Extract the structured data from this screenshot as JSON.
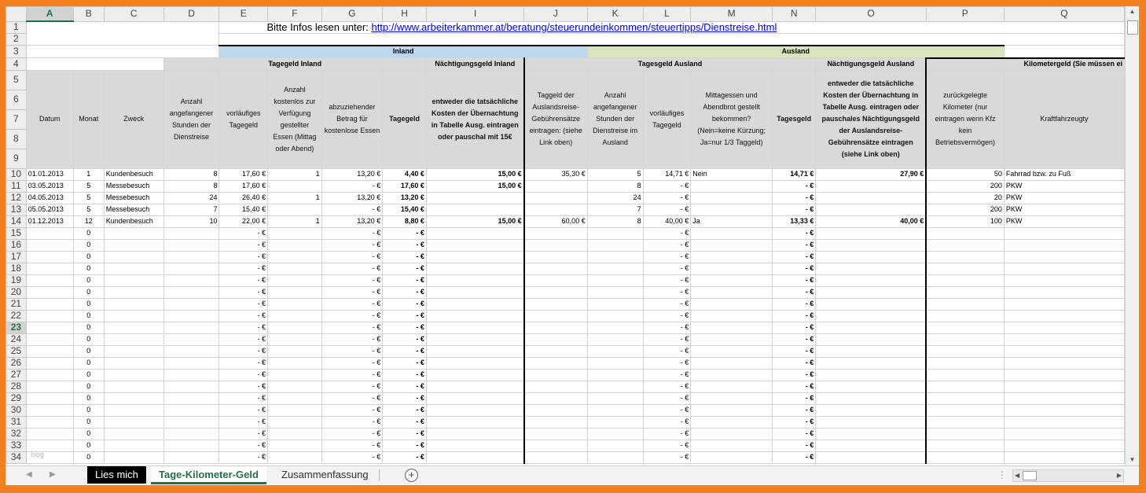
{
  "column_headers": [
    "A",
    "B",
    "C",
    "D",
    "E",
    "F",
    "G",
    "H",
    "I",
    "J",
    "K",
    "L",
    "M",
    "N",
    "O",
    "P",
    "Q"
  ],
  "selected_column": "A",
  "selected_row": "23",
  "info": {
    "label": "Bitte Infos lesen unter:",
    "link": "http://www.arbeiterkammer.at/beratung/steuerundeinkommen/steuertipps/Dienstreise.html"
  },
  "bands": {
    "inland": "Inland",
    "ausland": "Ausland",
    "tagegeld_inland": "Tagegeld Inland",
    "naechtigung_inland": "Nächtigungsgeld Inland",
    "tagegeld_ausland": "Tagesgeld Ausland",
    "naechtigung_ausland": "Nächtigungsgeld Ausland",
    "kilometergeld": "Kilometergeld (Sie müssen ei"
  },
  "headers": {
    "datum": "Datum",
    "monat": "Monat",
    "zweck": "Zweck",
    "d": "Anzahl angefangener Stunden der Dienstreise",
    "e": "vorläufiges Tagegeld",
    "f": "Anzahl kostenlos zur Verfügung gestellter Essen (Mittag oder Abend)",
    "g": "abzuziehender Betrag für kostenlose Essen",
    "h": "Tagegeld",
    "i": "entweder die tatsächliche Kosten der Übernachtung in Tabelle Ausg. eintragen oder pauschal mit 15€",
    "j": "Taggeld der Auslandsreise-Gebührensätze eintragen: (siehe Link oben)",
    "k": "Anzahl angefangener Stunden der Dienstreise im Ausland",
    "l": "vorläufiges Tagegeld",
    "m": "Mittagessen und Abendbrot gestellt bekommen? (Nein=keine Kürzung; Ja=nur 1/3 Taggeld)",
    "n": "Tagesgeld",
    "o": "entweder die tatsächliche Kosten der Übernachtung in Tabelle Ausg. eintragen oder pauschales Nächtigungsgeld der Auslandsreise-Gebührensätze eintragen (siehe Link oben)",
    "p": "zurückgelegte Kilometer (nur eintragen wenn Kfz kein Betriebsvermögen)",
    "q": "Kraftfahrzeugty"
  },
  "data_rows": [
    {
      "row": "10",
      "a": "01.01.2013",
      "b": "1",
      "c": "Kundenbesuch",
      "d": "8",
      "e": "17,60 €",
      "f": "1",
      "g": "13,20 €",
      "h": "4,40 €",
      "i": "15,00 €",
      "j": "35,30 €",
      "k": "5",
      "l": "14,71 €",
      "m": "Nein",
      "n": "14,71 €",
      "o": "27,90 €",
      "p": "50",
      "q": "Fahrrad bzw. zu Fuß"
    },
    {
      "row": "11",
      "a": "03.05.2013",
      "b": "5",
      "c": "Messebesuch",
      "d": "8",
      "e": "17,60 €",
      "f": "",
      "g": "-   €",
      "h": "17,60 €",
      "i": "15,00 €",
      "j": "",
      "k": "8",
      "l": "-   €",
      "m": "",
      "n": "-   €",
      "o": "",
      "p": "200",
      "q": "PKW"
    },
    {
      "row": "12",
      "a": "04.05.2013",
      "b": "5",
      "c": "Messebesuch",
      "d": "24",
      "e": "26,40 €",
      "f": "1",
      "g": "13,20 €",
      "h": "13,20 €",
      "i": "",
      "j": "",
      "k": "24",
      "l": "-   €",
      "m": "",
      "n": "-   €",
      "o": "",
      "p": "20",
      "q": "PKW"
    },
    {
      "row": "13",
      "a": "05.05.2013",
      "b": "5",
      "c": "Messebesuch",
      "d": "7",
      "e": "15,40 €",
      "f": "",
      "g": "-   €",
      "h": "15,40 €",
      "i": "",
      "j": "",
      "k": "7",
      "l": "-   €",
      "m": "",
      "n": "-   €",
      "o": "",
      "p": "200",
      "q": "PKW"
    },
    {
      "row": "14",
      "a": "01.12.2013",
      "b": "12",
      "c": "Kundenbesuch",
      "d": "10",
      "e": "22,00 €",
      "f": "1",
      "g": "13,20 €",
      "h": "8,80 €",
      "i": "15,00 €",
      "j": "60,00 €",
      "k": "8",
      "l": "40,00 €",
      "m": "Ja",
      "n": "13,33 €",
      "o": "40,00 €",
      "p": "100",
      "q": "PKW"
    }
  ],
  "empty_rows": [
    "15",
    "16",
    "17",
    "18",
    "19",
    "20",
    "21",
    "22",
    "23",
    "24",
    "25",
    "26",
    "27",
    "28",
    "29",
    "30",
    "31",
    "32",
    "33",
    "34"
  ],
  "empty_values": {
    "b": "0",
    "dash": "-   €"
  },
  "tabs": [
    {
      "label": "Lies mich",
      "style": "dark"
    },
    {
      "label": "Tage-Kilometer-Geld",
      "style": "active"
    },
    {
      "label": "Zusammenfassung",
      "style": "plain"
    }
  ],
  "watermark": "blog"
}
